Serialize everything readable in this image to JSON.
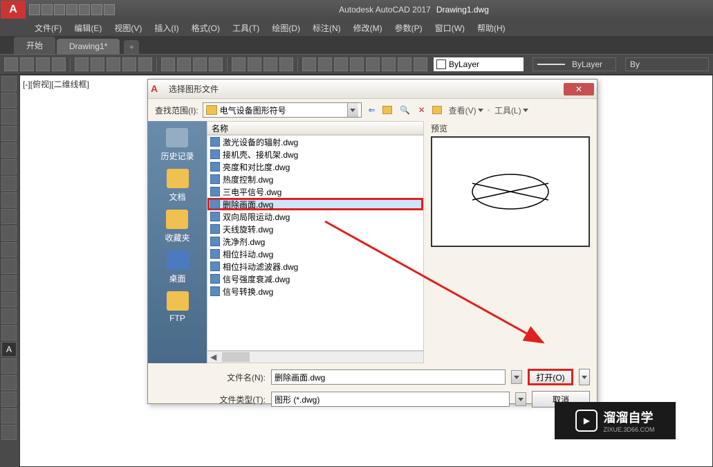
{
  "app": {
    "name": "Autodesk AutoCAD 2017",
    "document": "Drawing1.dwg"
  },
  "menu": [
    "文件(F)",
    "编辑(E)",
    "视图(V)",
    "插入(I)",
    "格式(O)",
    "工具(T)",
    "绘图(D)",
    "标注(N)",
    "修改(M)",
    "参数(P)",
    "窗口(W)",
    "帮助(H)"
  ],
  "tabs": {
    "start": "开始",
    "drawing": "Drawing1*"
  },
  "bylayer": {
    "label": "ByLayer",
    "label2": "ByLayer",
    "label3": "By"
  },
  "viewport_label": "[-][俯视][二维线框]",
  "dialog": {
    "title": "选择图形文件",
    "look_in_label": "查找范围(I):",
    "look_in_value": "电气设备图形符号",
    "view_btn": "查看(V)",
    "tools_btn": "工具(L)",
    "name_col": "名称",
    "preview_label": "预览",
    "places": {
      "history": "历史记录",
      "docs": "文档",
      "favorites": "收藏夹",
      "desktop": "桌面",
      "ftp": "FTP"
    },
    "files": [
      "激光设备的辐射.dwg",
      "接机壳、接机架.dwg",
      "亮度和对比度.dwg",
      "热度控制.dwg",
      "三电平信号.dwg",
      "删除画面.dwg",
      "双向局限运动.dwg",
      "天线旋转.dwg",
      "洗净剂.dwg",
      "相位抖动.dwg",
      "相位抖动滤波器.dwg",
      "信号强度衰减.dwg",
      "信号转换.dwg"
    ],
    "filename_label": "文件名(N):",
    "filename_value": "删除画面.dwg",
    "filetype_label": "文件类型(T):",
    "filetype_value": "图形 (*.dwg)",
    "open_btn": "打开(O)",
    "cancel_btn": "取消"
  },
  "watermark": {
    "title": "溜溜自学",
    "url": "ZIXUE.3D66.COM"
  }
}
